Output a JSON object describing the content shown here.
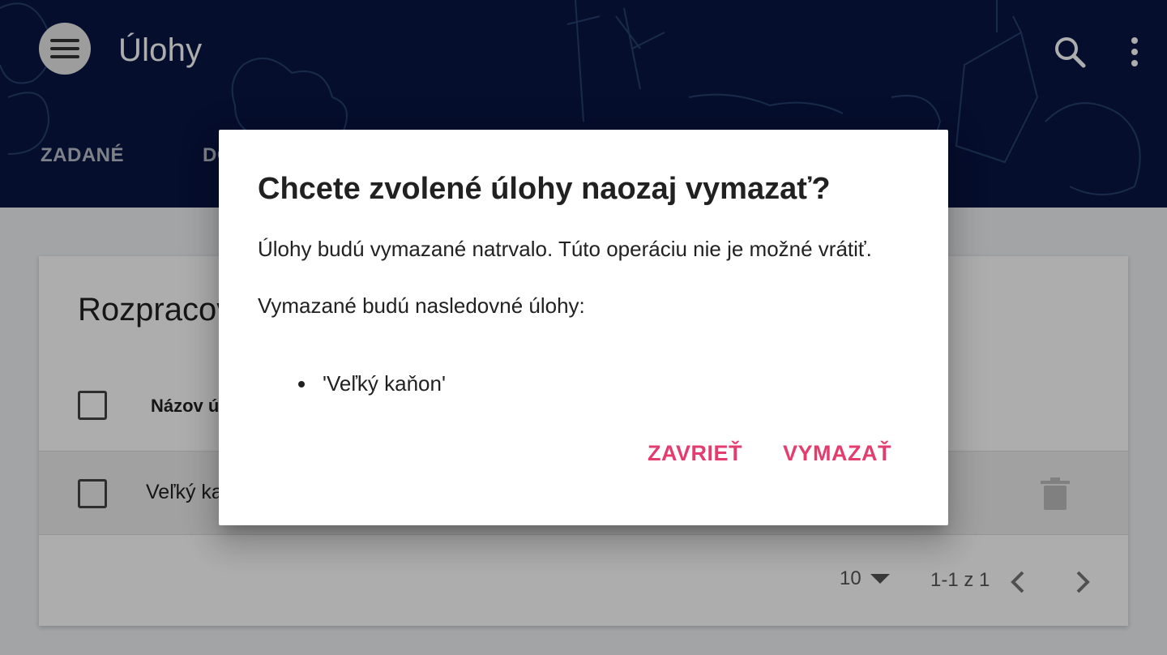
{
  "appbar": {
    "title": "Úlohy",
    "menu_icon": "hamburger-menu-icon",
    "search_icon": "search-icon",
    "more_icon": "more-vert-icon",
    "background_color": "#091643",
    "tabs": [
      {
        "label": "ZADANÉ"
      },
      {
        "label": "DO"
      }
    ]
  },
  "card": {
    "title": "Rozpracov",
    "column_name_label": "Názov ú",
    "rows": [
      {
        "name": "Veľký ka"
      }
    ],
    "footer": {
      "per_page": "10",
      "range": "1-1 z 1"
    }
  },
  "dialog": {
    "title": "Chcete zvolené úlohy naozaj vymazať?",
    "text": "Úlohy budú vymazané natrvalo. Túto operáciu nie je možné vrátiť.",
    "subtitle": "Vymazané budú nasledovné úlohy:",
    "items": [
      "'Veľký kaňon'"
    ],
    "close_label": "ZAVRIEŤ",
    "delete_label": "VYMAZAŤ",
    "accent_color": "#e53c6f"
  }
}
